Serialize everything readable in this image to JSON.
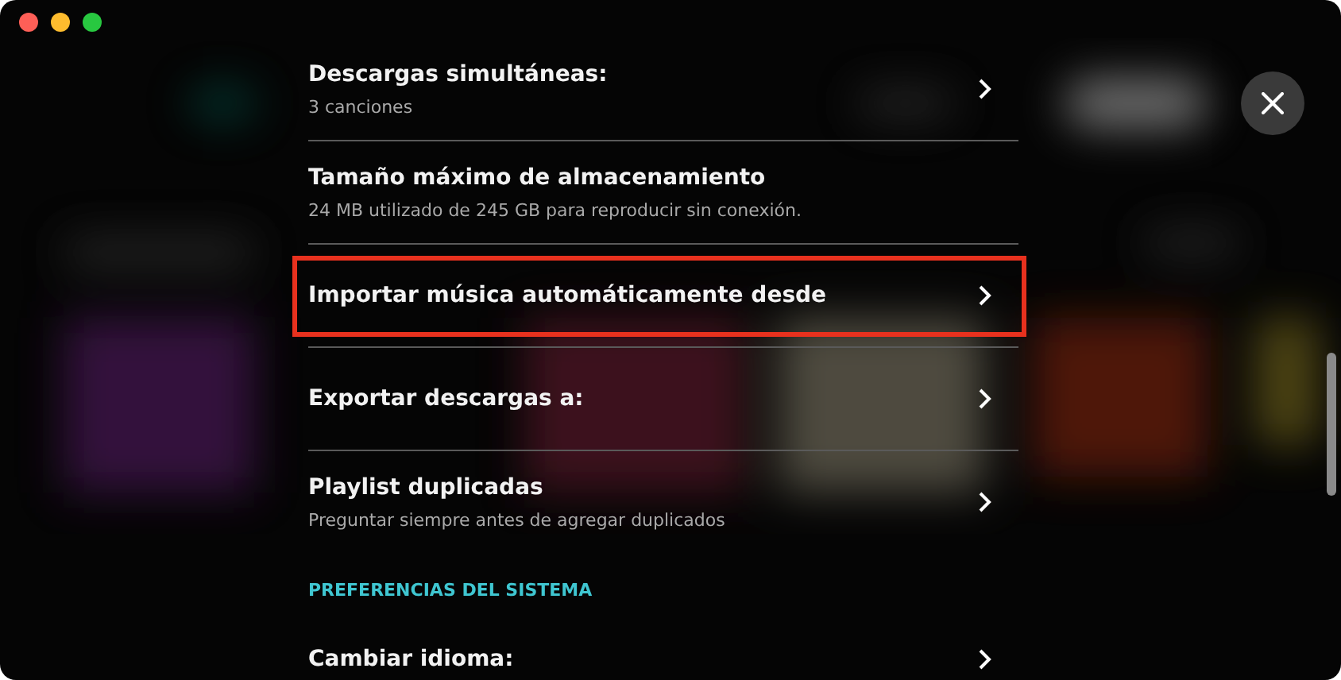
{
  "items": [
    {
      "kind": "setting",
      "title": "Descargas simultáneas:",
      "subtitle": "3 canciones",
      "chevron": true,
      "highlighted": false
    },
    {
      "kind": "setting",
      "title": "Tamaño máximo de almacenamiento",
      "subtitle": "24 MB utilizado de 245 GB para reproducir sin conexión.",
      "chevron": false,
      "highlighted": false
    },
    {
      "kind": "setting",
      "title": "Importar música automáticamente desde",
      "chevron": true,
      "highlighted": true
    },
    {
      "kind": "setting",
      "title": "Exportar descargas a:",
      "chevron": true,
      "highlighted": false
    },
    {
      "kind": "setting",
      "title": "Playlist duplicadas",
      "subtitle": "Preguntar siempre antes de agregar duplicados",
      "chevron": true,
      "highlighted": false
    },
    {
      "kind": "header",
      "label": "PREFERENCIAS DEL SISTEMA"
    },
    {
      "kind": "setting",
      "title": "Cambiar idioma:",
      "chevron": true,
      "highlighted": false
    }
  ]
}
